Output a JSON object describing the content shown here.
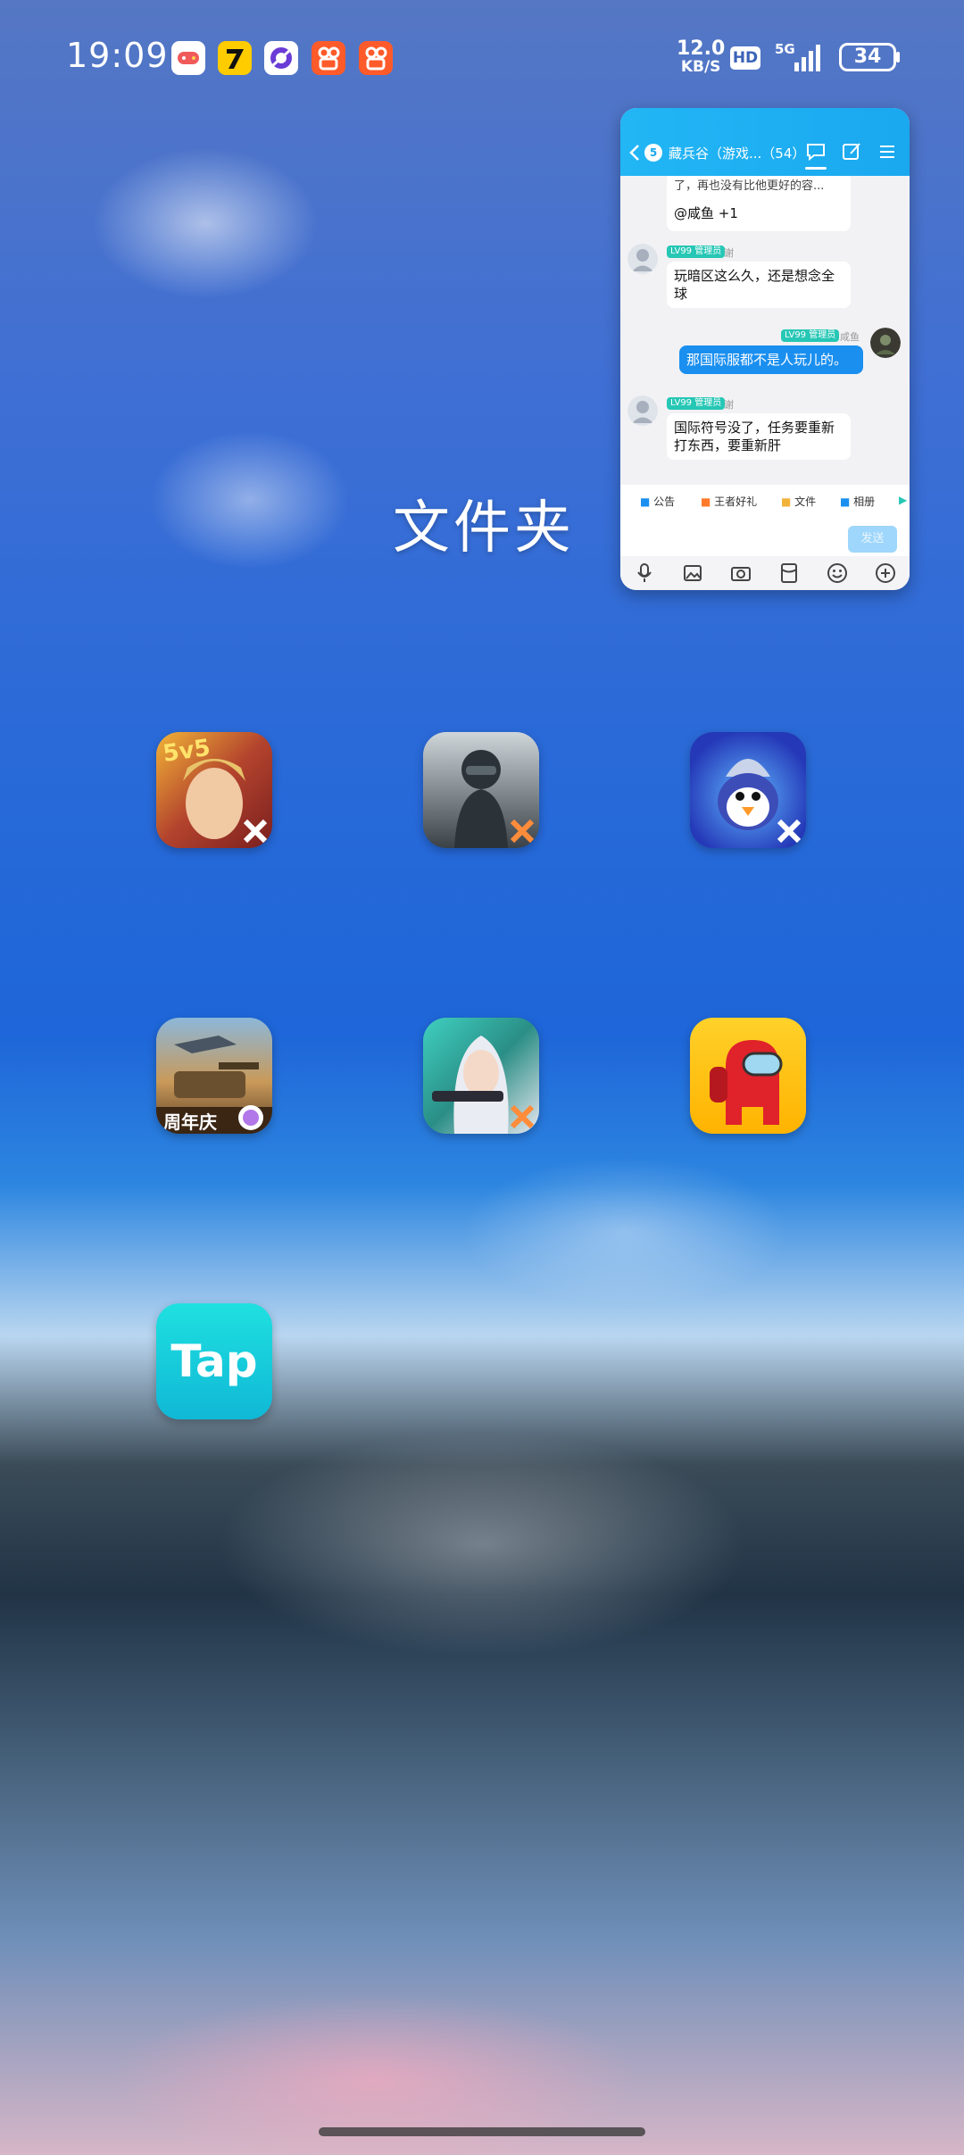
{
  "status_bar": {
    "time": "19:09",
    "net_speed_value": "12.0",
    "net_speed_unit": "KB/S",
    "hd": "HD",
    "network": "5G",
    "battery": "34",
    "notification_icons": [
      "game-center-icon",
      "seven-app-icon",
      "browser-icon",
      "kuaishou-icon",
      "kuaishou-icon"
    ]
  },
  "folder": {
    "title": "文件夹",
    "apps": [
      {
        "icon": "honor-of-kings-icon"
      },
      {
        "icon": "pubg-mobile-icon"
      },
      {
        "icon": "auto-chess-penguin-icon"
      },
      {
        "icon": "tank-game-icon",
        "badge": "周年庆"
      },
      {
        "icon": "hooded-shooter-game-icon"
      },
      {
        "icon": "among-us-icon"
      },
      {
        "icon": "taptap-icon",
        "label": "Tap"
      }
    ]
  },
  "floating_chat": {
    "badge": "5",
    "title": "藏兵谷（游戏...（54）",
    "messages": [
      {
        "side": "left",
        "partial_text": "了，再也没有比他更好的容...",
        "text": "@咸鱼 +1"
      },
      {
        "side": "left",
        "role": "LV99 管理员",
        "nick": "谢",
        "text": "玩暗区这么久，还是想念全球"
      },
      {
        "side": "right",
        "role": "LV99 管理员",
        "nick": "咸鱼",
        "text": "那国际服都不是人玩儿的。"
      },
      {
        "side": "left",
        "role": "LV99 管理员",
        "nick": "谢",
        "text": "国际符号没了，任务要重新打东西，要重新肝"
      }
    ],
    "quick_bar": [
      "公告",
      "王者好礼",
      "文件",
      "相册"
    ],
    "input_placeholder": "",
    "send_label": "发送",
    "toolbar_icons": [
      "microphone-icon",
      "image-icon",
      "camera-icon",
      "red-packet-icon",
      "emoji-icon",
      "plus-icon"
    ]
  },
  "colors": {
    "chat_header": "#1aa8ef",
    "bubble_self": "#1a8ff0",
    "role_tag": "#27c7b5"
  }
}
